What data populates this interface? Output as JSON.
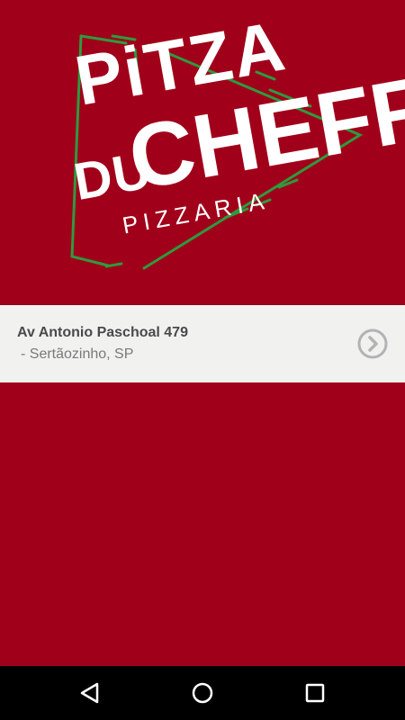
{
  "brand": {
    "line1": "PiTZA",
    "line2": "DU",
    "line3": "CHEFF",
    "tagline": "PIZZARIA",
    "colors": {
      "background": "#a1001a",
      "logo_text": "#ffffff",
      "logo_accent": "#2e9a3e"
    }
  },
  "address": {
    "street": "Av Antonio Paschoal 479",
    "city": "- Sertãozinho, SP",
    "action_icon": "chevron-right-circle-icon"
  },
  "navigation_bar": {
    "back_icon": "back-triangle-icon",
    "home_icon": "home-circle-icon",
    "recents_icon": "recents-square-icon"
  }
}
